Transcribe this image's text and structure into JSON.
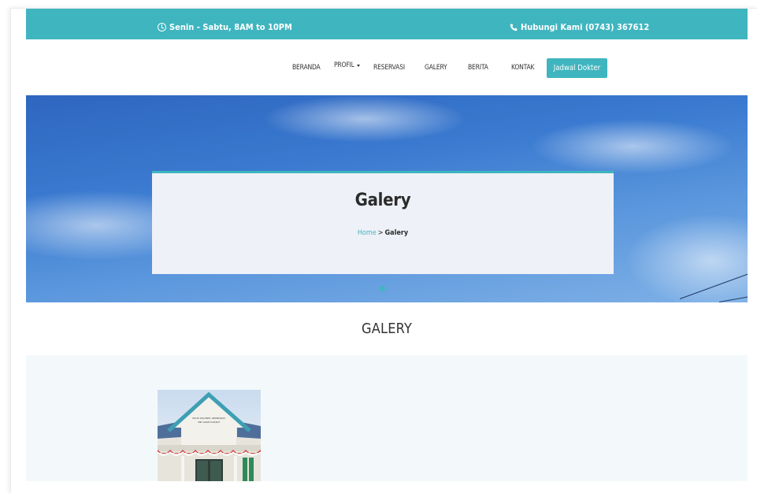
{
  "topbar": {
    "hours": "Senin - Sabtu, 8AM to 10PM",
    "contact": "Hubungi Kami (0743) 367612"
  },
  "nav": {
    "items": [
      "BERANDA",
      "PROFIL",
      "RESERVASI",
      "GALERY",
      "BERITA",
      "KONTAK"
    ],
    "cta": "Jadwal Dokter"
  },
  "hero": {
    "title": "Galery",
    "breadcrumb": {
      "home": "Home",
      "separator": ">",
      "current": "Galery"
    }
  },
  "section": {
    "title": "GALERY"
  },
  "gallery": {
    "sign_text": "RSUD KOLONEL ABUNDJANI",
    "sign_subtext": "UNIT GAWAT DARURAT"
  },
  "colors": {
    "accent": "#3fb5bf",
    "sky": "#3a7ad0",
    "card": "#eef1f7",
    "section_bg": "#f3f9fb"
  },
  "icons": [
    "clock-icon",
    "phone-icon",
    "caret-down-icon"
  ]
}
